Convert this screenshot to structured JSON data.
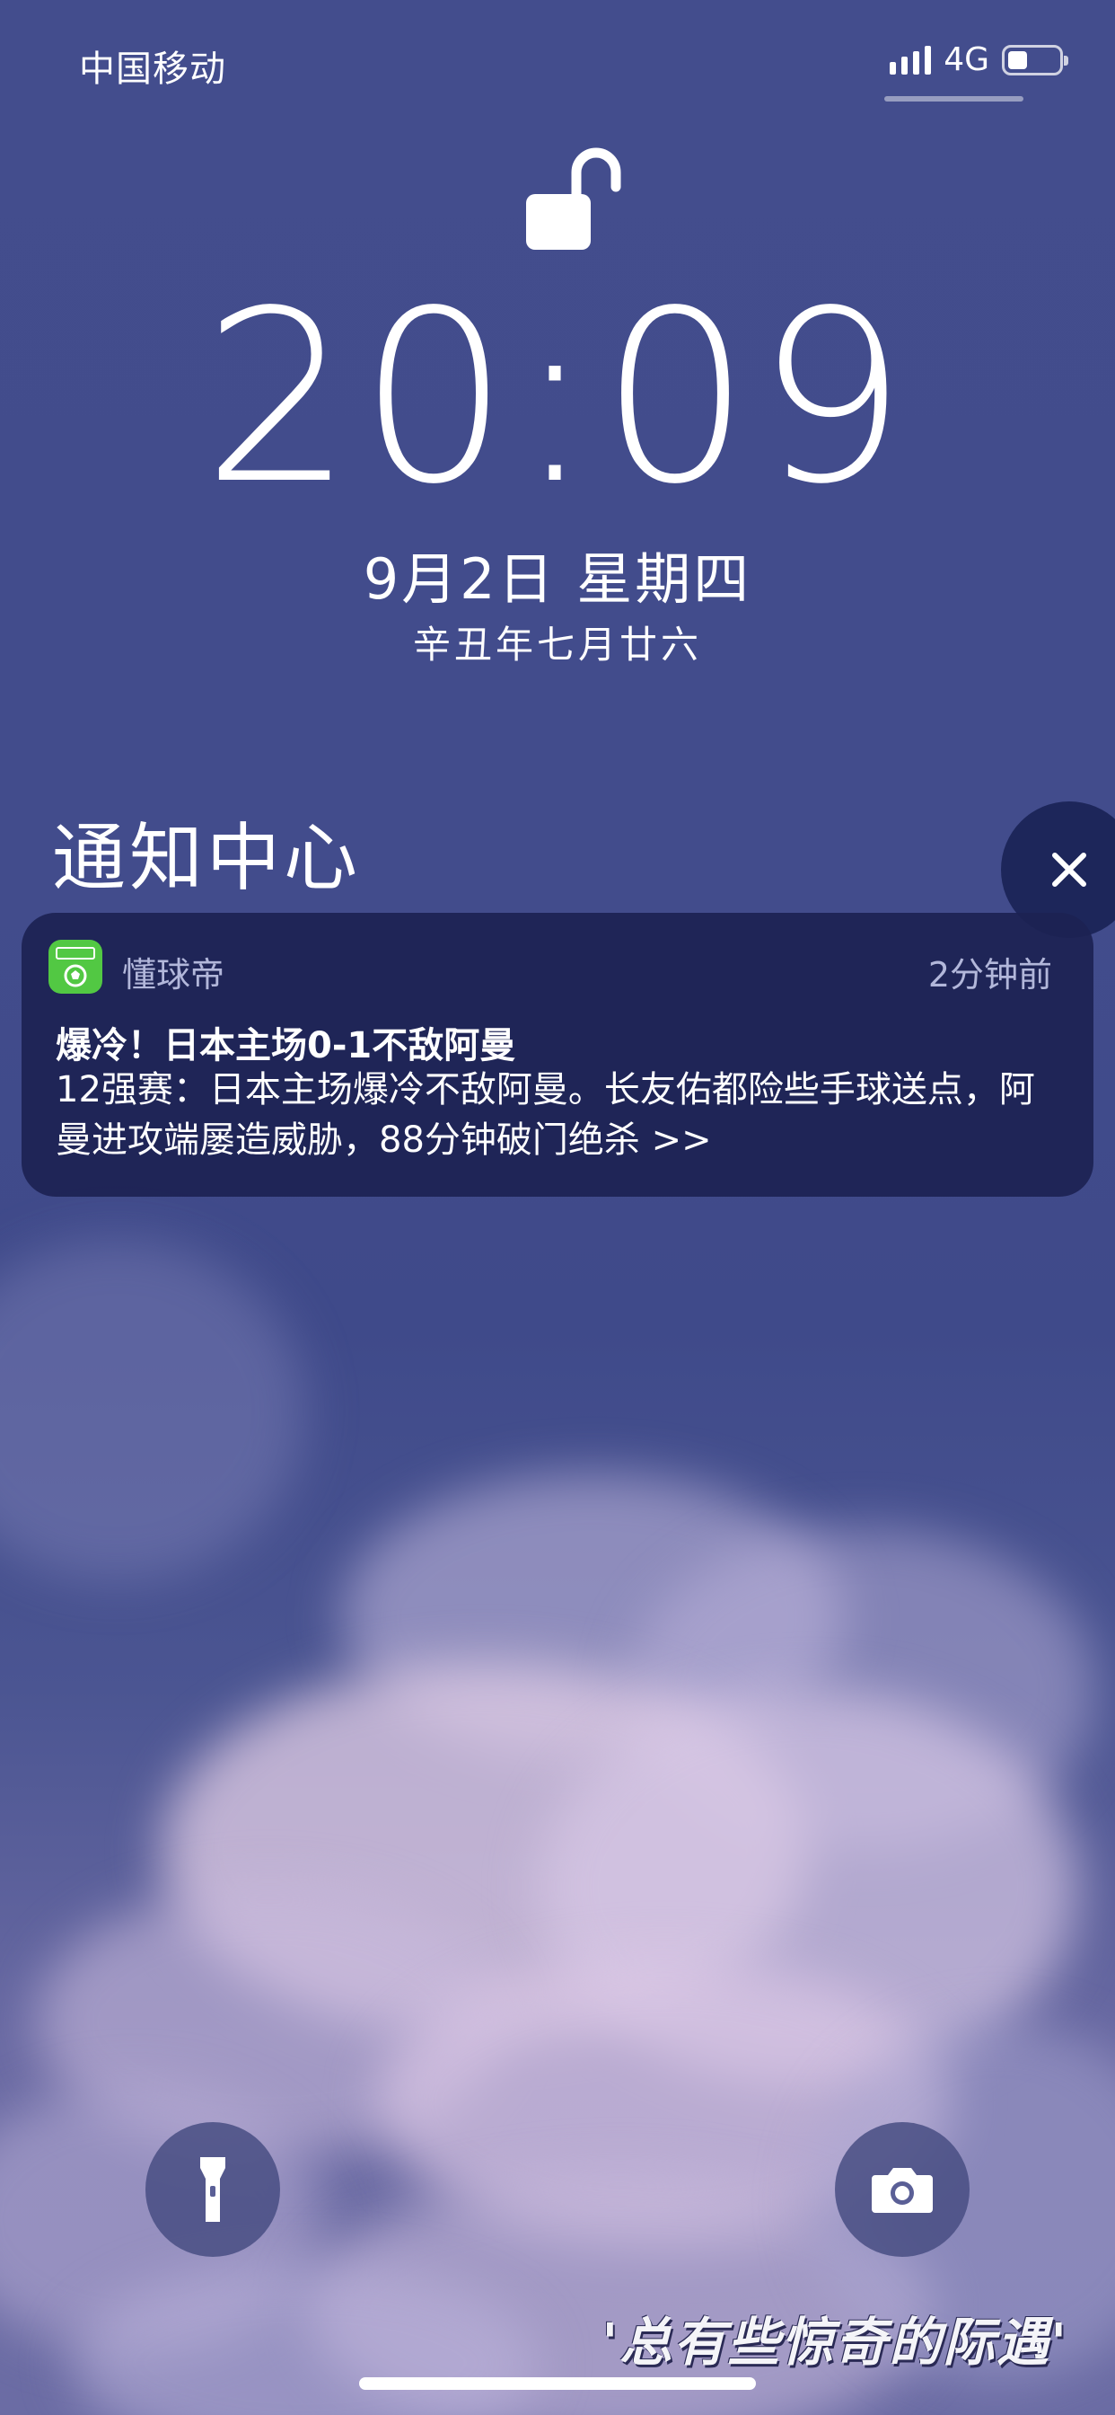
{
  "status_bar": {
    "carrier": "中国移动",
    "network": "4G",
    "battery_level": 0.34,
    "signal_bars": 4
  },
  "lock_screen": {
    "lock_state": "unlocked",
    "time": "20:09",
    "date": "9月2日 星期四",
    "lunar_date": "辛丑年七月廿六"
  },
  "notification_center": {
    "title": "通知中心",
    "clear_icon": "close-icon"
  },
  "notifications": [
    {
      "app_name": "懂球帝",
      "time_ago": "2分钟前",
      "title": "爆冷！日本主场0-1不敌阿曼",
      "body": "12强赛：日本主场爆冷不敌阿曼。长友佑都险些手球送点，阿曼进攻端屡造威胁，88分钟破门绝杀 >>"
    }
  ],
  "quick_actions": {
    "left_icon": "flashlight-icon",
    "right_icon": "camera-icon"
  },
  "wallpaper": {
    "caption": "'总有些惊奇的际遇'"
  },
  "colors": {
    "sky": "#424c8c",
    "card": "#1c2252",
    "app_icon": "#52c843"
  }
}
